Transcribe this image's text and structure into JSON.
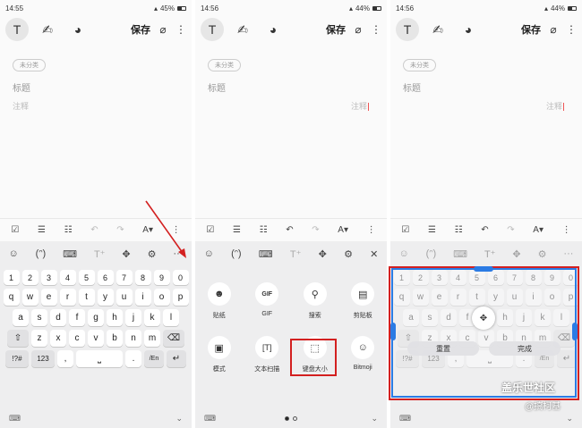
{
  "screens": [
    {
      "time": "14:55",
      "battery": "45%",
      "battery_level": 0.45
    },
    {
      "time": "14:56",
      "battery": "44%",
      "battery_level": 0.44
    },
    {
      "time": "14:56",
      "battery": "44%",
      "battery_level": 0.44
    }
  ],
  "note": {
    "save_label": "保存",
    "category_chip": "未分类",
    "title_placeholder": "标题",
    "body_placeholder": "注释"
  },
  "format_bar": {
    "font_size_label": "A"
  },
  "keyboard": {
    "number_row": [
      "1",
      "2",
      "3",
      "4",
      "5",
      "6",
      "7",
      "8",
      "9",
      "0"
    ],
    "row1": [
      "q",
      "w",
      "e",
      "r",
      "t",
      "y",
      "u",
      "i",
      "o",
      "p"
    ],
    "row2": [
      "a",
      "s",
      "d",
      "f",
      "g",
      "h",
      "j",
      "k",
      "l"
    ],
    "row3": [
      "z",
      "x",
      "c",
      "v",
      "b",
      "n",
      "m"
    ],
    "symbols_label": "!?#",
    "numbers_label": "123",
    "comma_label": ",",
    "period_label": ".",
    "lang_label": "/En"
  },
  "panel_items": [
    {
      "label": "贴纸",
      "icon": "sticker-icon"
    },
    {
      "label": "GIF",
      "icon": "gif-icon"
    },
    {
      "label": "搜索",
      "icon": "search-icon"
    },
    {
      "label": "剪贴板",
      "icon": "clipboard-icon"
    },
    {
      "label": "模式",
      "icon": "mode-icon"
    },
    {
      "label": "文本扫描",
      "icon": "text-scan-icon"
    },
    {
      "label": "键盘大小",
      "icon": "keyboard-size-icon"
    },
    {
      "label": "Bitmoji",
      "icon": "bitmoji-icon"
    }
  ],
  "resize": {
    "reset_label": "重置",
    "done_label": "完成"
  },
  "watermark": {
    "line1": "盖乐世社区",
    "line2": "@搞柯基"
  },
  "colors": {
    "annotation_red": "#d32020",
    "resize_blue": "#2b7be4"
  }
}
